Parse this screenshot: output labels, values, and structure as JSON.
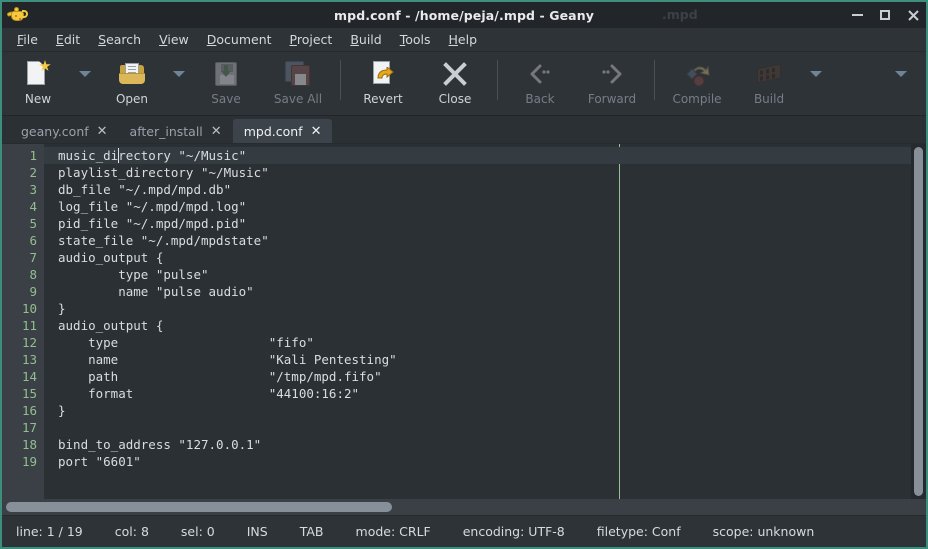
{
  "window": {
    "title": "mpd.conf - /home/peja/.mpd - Geany",
    "ghost_title": ".mpd",
    "app_icon": "geany-lamp-icon",
    "accent_border": "#3e8e7e",
    "controls": {
      "minimize": "minimize-icon",
      "maximize": "maximize-icon",
      "close": "close-icon"
    }
  },
  "menubar": {
    "items": [
      {
        "mnemonic": "F",
        "rest": "ile"
      },
      {
        "mnemonic": "E",
        "rest": "dit"
      },
      {
        "mnemonic": "S",
        "rest": "earch"
      },
      {
        "mnemonic": "V",
        "rest": "iew"
      },
      {
        "mnemonic": "D",
        "rest": "ocument"
      },
      {
        "mnemonic": "P",
        "rest": "roject"
      },
      {
        "mnemonic": "B",
        "rest": "uild"
      },
      {
        "mnemonic": "T",
        "rest": "ools"
      },
      {
        "mnemonic": "H",
        "rest": "elp"
      }
    ]
  },
  "toolbar": {
    "new_label": "New",
    "open_label": "Open",
    "save_label": "Save",
    "save_all_label": "Save All",
    "revert_label": "Revert",
    "close_label": "Close",
    "back_label": "Back",
    "forward_label": "Forward",
    "compile_label": "Compile",
    "build_label": "Build"
  },
  "tabs": [
    {
      "label": "geany.conf",
      "active": false
    },
    {
      "label": "after_install",
      "active": false
    },
    {
      "label": "mpd.conf",
      "active": true
    }
  ],
  "editor": {
    "line_numbers": [
      "1",
      "2",
      "3",
      "4",
      "5",
      "6",
      "7",
      "8",
      "9",
      "10",
      "11",
      "12",
      "13",
      "14",
      "15",
      "16",
      "17",
      "18",
      "19"
    ],
    "lines": [
      "music_directory \"~/Music\"",
      "playlist_directory \"~/Music\"",
      "db_file \"~/.mpd/mpd.db\"",
      "log_file \"~/.mpd/mpd.log\"",
      "pid_file \"~/.mpd/mpd.pid\"",
      "state_file \"~/.mpd/mpdstate\"",
      "audio_output {",
      "        type \"pulse\"",
      "        name \"pulse audio\"",
      "}",
      "audio_output {",
      "    type                    \"fifo\"",
      "    name                    \"Kali Pentesting\"",
      "    path                    \"/tmp/mpd.fifo\"",
      "    format                  \"44100:16:2\"",
      "}",
      "",
      "bind_to_address \"127.0.0.1\"",
      "port \"6601\""
    ],
    "current_line_index": 0,
    "caret_column": 8
  },
  "statusbar": {
    "line": "line: 1 / 19",
    "col": "col: 8",
    "sel": "sel: 0",
    "overwrite": "INS",
    "indent": "TAB",
    "mode": "mode: CRLF",
    "encoding": "encoding: UTF-8",
    "filetype": "filetype: Conf",
    "scope": "scope: unknown"
  }
}
